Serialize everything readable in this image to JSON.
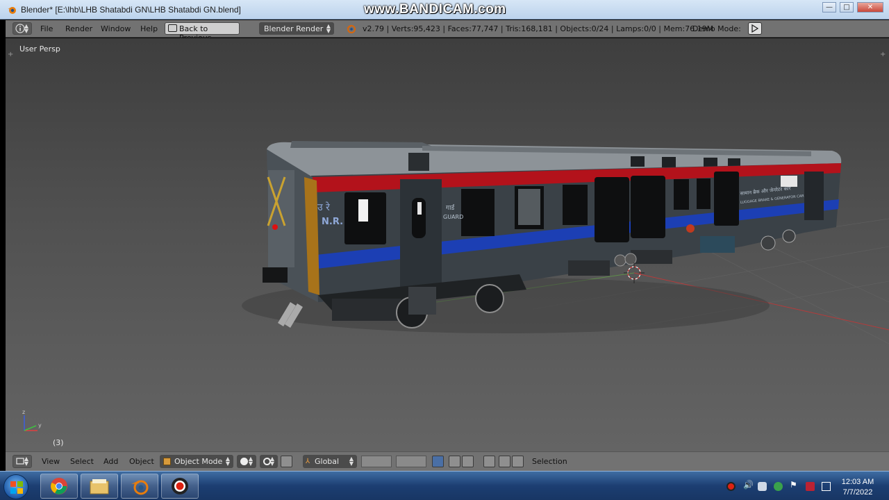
{
  "window": {
    "title": "Blender* [E:\\lhb\\LHB Shatabdi GN\\LHB Shatabdi GN.blend]",
    "watermark": "www.BANDICAM.com",
    "minimize_label": "—",
    "maximize_label": "□",
    "close_label": "✕"
  },
  "info_header": {
    "menus": [
      "File",
      "Render",
      "Window",
      "Help"
    ],
    "back_to_previous": "Back to Previous",
    "render_engine": "Blender Render",
    "stats": "v2.79 | Verts:95,423 | Faces:77,747 | Tris:168,181 | Objects:0/24 | Lamps:0/0 | Mem:76.19M",
    "demo_mode": "Demo Mode:"
  },
  "viewport": {
    "view_label": "User Persp",
    "frame_counter": "(3)",
    "coach_texts": {
      "nr": "N.R.",
      "guard": "GUARD",
      "hindi_guard": "गार्ड",
      "hindi_ur": "उ रे",
      "side_label": "LUGGAGE BRAKE & GENERATOR CAR",
      "hindi_side_label": "सामान ब्रेक और जेनरेटर कार"
    },
    "axis_labels": {
      "x": "x",
      "y": "y",
      "z": "z"
    }
  },
  "view3d_header": {
    "menus": [
      "View",
      "Select",
      "Add",
      "Object"
    ],
    "mode": "Object Mode",
    "orientation": "Global",
    "selection_label": "Selection"
  },
  "taskbar": {
    "time": "12:03 AM",
    "date": "7/7/2022",
    "apps": [
      "chrome-icon",
      "file-explorer-icon",
      "blender-icon",
      "bandicam-icon"
    ]
  },
  "colors": {
    "coach_body": "#3a4147",
    "coach_roof": "#8d9398",
    "red_stripe": "#b3121b",
    "blue_stripe": "#1c3fb4",
    "ui_header": "#727272"
  }
}
